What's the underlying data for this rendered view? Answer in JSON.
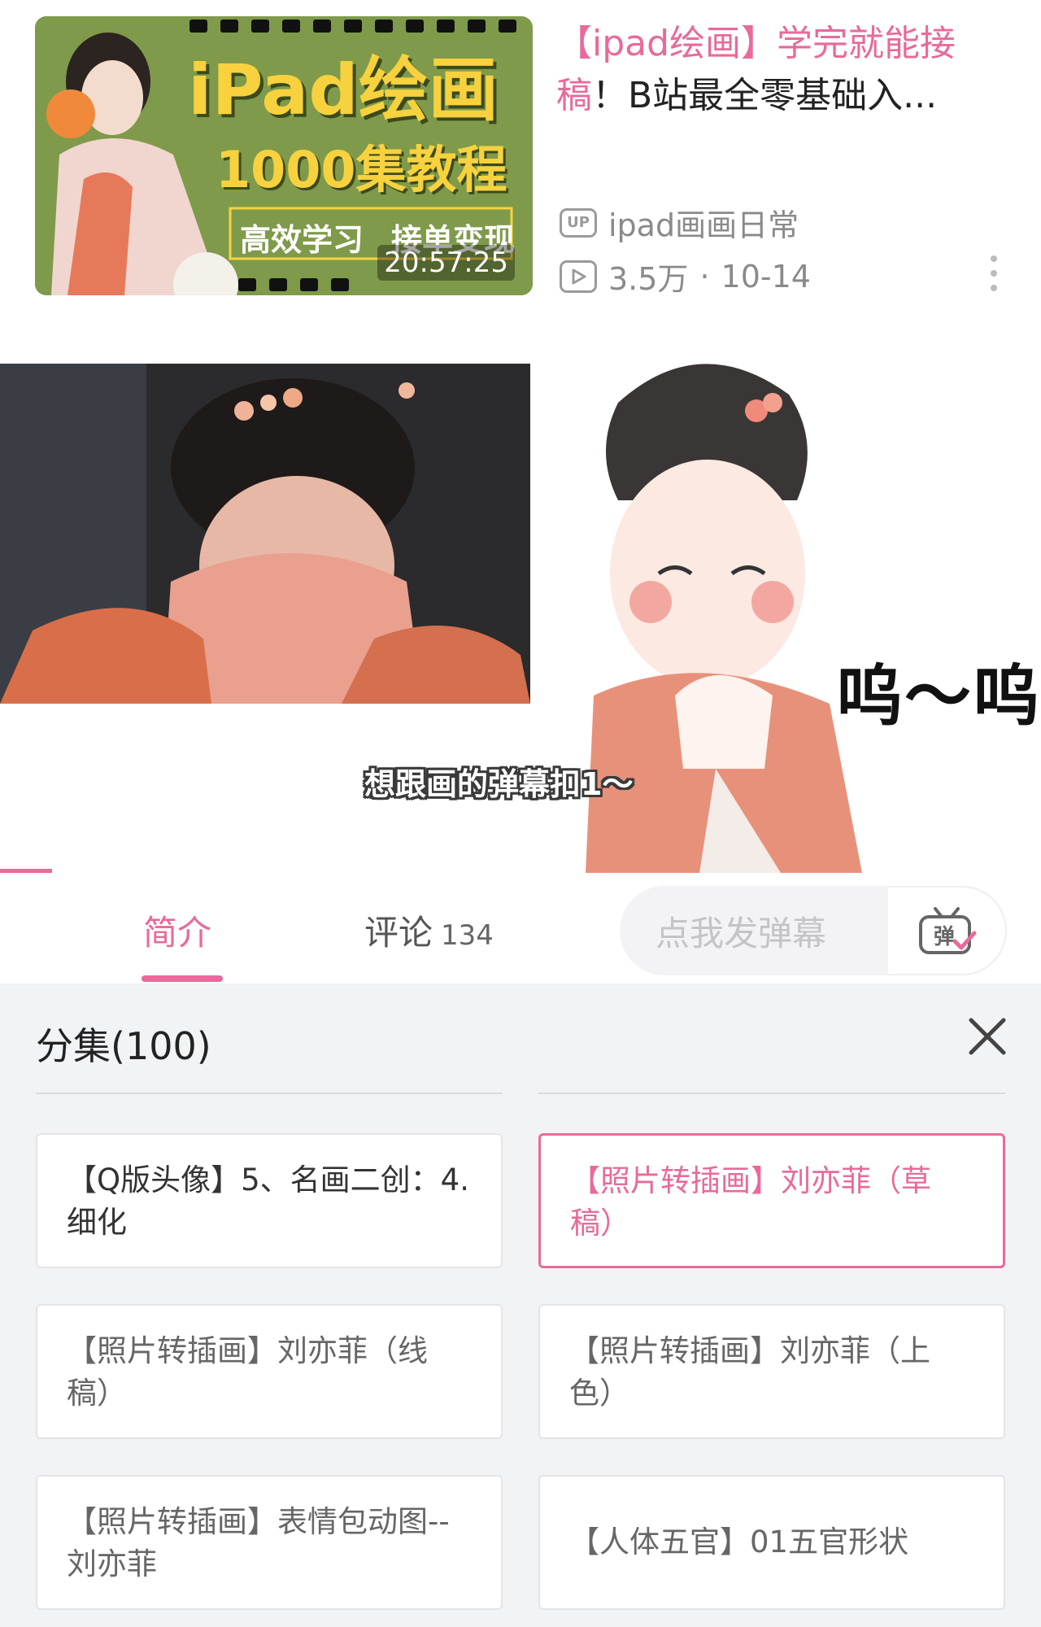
{
  "recommended": {
    "thumb_title": "iPad绘画",
    "thumb_subtitle": "1000集教程",
    "thumb_tag_left": "高效学习",
    "thumb_tag_right": "接单变现",
    "duration": "20:57:25",
    "title_hl_a": "【ipad绘画】学完就能接",
    "title_hl_b": "稿",
    "title_rest": "！B站最全零基础入...",
    "up_badge": "UP",
    "author": "ipad画画日常",
    "views": "3.5万",
    "separator": "·",
    "date": "10-14"
  },
  "player": {
    "danmaku_hint": "想跟画的弹幕扣1～",
    "cry_text": "呜～呜",
    "progress_fraction": 0.05
  },
  "tabs": {
    "intro": "简介",
    "comments": "评论",
    "comments_count": "134",
    "danmaku_placeholder": "点我发弹幕",
    "danmaku_toggle": "弹"
  },
  "episodes": {
    "header": "分集(100)",
    "items": [
      {
        "label": "【Q版头像】5、名画二创：4.细化"
      },
      {
        "label": "【照片转插画】刘亦菲（草稿）",
        "active": true
      },
      {
        "label": "【照片转插画】刘亦菲（线稿）"
      },
      {
        "label": "【照片转插画】刘亦菲（上色）"
      },
      {
        "label": "【照片转插画】表情包动图--刘亦菲"
      },
      {
        "label": "【人体五官】01五官形状"
      }
    ]
  },
  "colors": {
    "accent": "#e86a9a",
    "thumb_green": "#7f9a4a",
    "title_yellow": "#f7d23e",
    "panel_bg": "#f2f3f5"
  }
}
